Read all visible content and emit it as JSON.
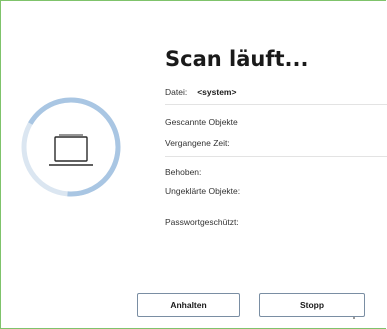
{
  "scan": {
    "title": "Scan läuft...",
    "file_label": "Datei:",
    "file_value": "<system>",
    "scanned_label": "Gescannte Objekte",
    "elapsed_label": "Vergangene Zeit:",
    "fixed_label": "Behoben:",
    "unresolved_label": "Ungeklärte Objekte:",
    "password_label": "Passwortgeschützt:"
  },
  "buttons": {
    "pause_label": "Anhalten",
    "stop_label": "Stopp"
  },
  "colors": {
    "frame_border": "#7fc36b",
    "ring_track": "#dbe6f1",
    "ring_progress": "#a9c6e3",
    "icon_stroke": "#2b2b2b"
  },
  "icon": {
    "scan_icon": "laptop-icon"
  }
}
